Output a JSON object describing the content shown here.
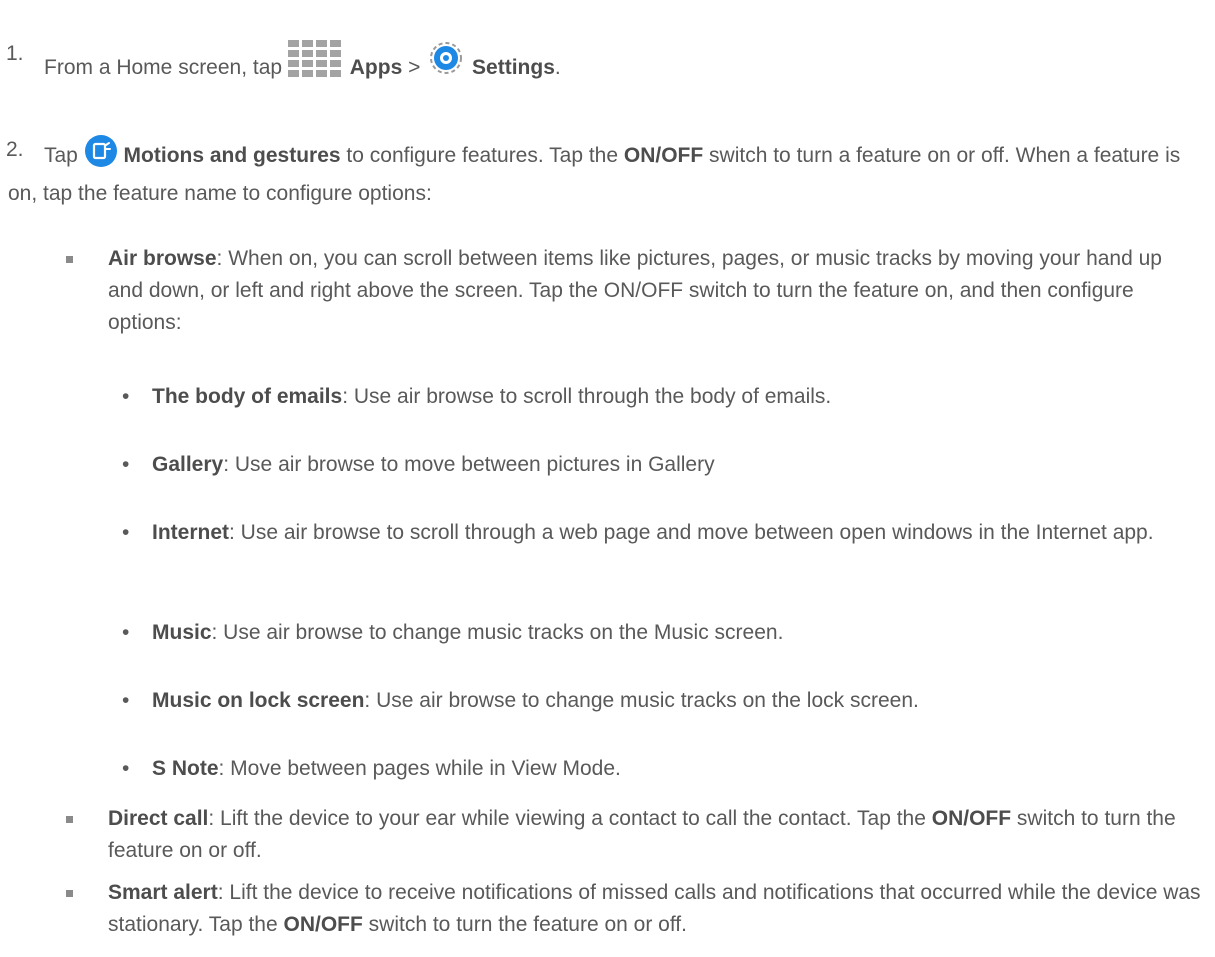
{
  "steps": [
    {
      "number": "1.",
      "parts": [
        "From a Home screen, tap ",
        "Apps",
        " > ",
        "Settings",
        "."
      ],
      "icons": [
        "apps-grid-icon",
        "settings-gear-icon"
      ]
    },
    {
      "number": "2.",
      "parts": [
        "Tap ",
        "Motions and gestures",
        " to configure features. Tap the ",
        "ON/OFF",
        " switch to turn a feature on or off. When a feature is on, tap the feature name to configure options:"
      ],
      "icons": [
        "motions-gestures-icon"
      ]
    }
  ],
  "features": [
    {
      "name": "Air browse",
      "text": ": When on, you can scroll between items like pictures, pages, or music tracks by moving your hand up and down, or left and right above the screen. Tap the ON/OFF switch to turn the feature on, and then configure options:",
      "options": [
        {
          "name": "The body of emails",
          "text": ": Use air browse to scroll through the body of emails."
        },
        {
          "name": "Gallery",
          "text": ": Use air browse to move between pictures in Gallery"
        },
        {
          "name": "Internet",
          "text": ": Use air browse to scroll through a web page and move between open windows in the Internet app."
        },
        {
          "name": "Music",
          "text": ": Use air browse to change music tracks on the Music screen."
        },
        {
          "name": "Music on lock screen",
          "text": ": Use air browse to change music tracks on the lock screen."
        },
        {
          "name": "S Note",
          "text": ": Move between pages while in View Mode."
        }
      ]
    },
    {
      "name": "Direct call",
      "text_parts": [
        ": Lift the device to your ear while viewing a contact to call the contact. Tap the ",
        "ON/OFF",
        " switch to turn the feature on or off."
      ]
    },
    {
      "name": "Smart alert",
      "text_parts": [
        ": Lift the device to receive notifications of missed calls and notifications that occurred while the device was stationary. Tap the ",
        "ON/OFF",
        " switch to turn the feature on or off."
      ]
    }
  ],
  "bullet_dot": "•",
  "colors": {
    "text": "#595959",
    "icon_blue": "#1e88e5",
    "icon_grey": "#9a9a9a"
  }
}
